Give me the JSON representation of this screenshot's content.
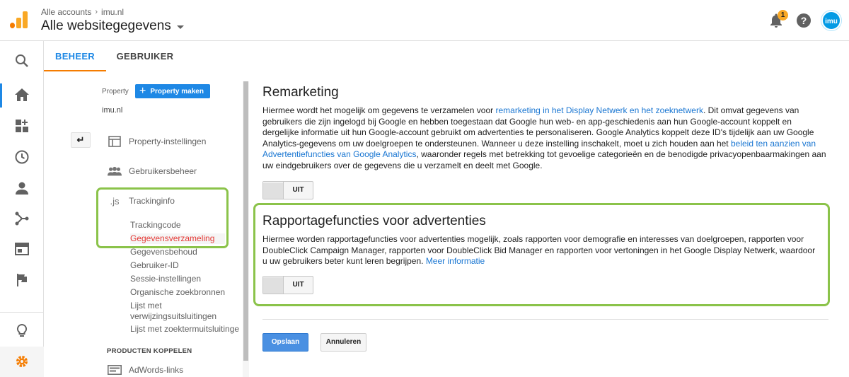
{
  "header": {
    "breadcrumb_account": "Alle accounts",
    "breadcrumb_property": "imu.nl",
    "title": "Alle websitegegevens",
    "notification_count": "1",
    "help_label": "?",
    "avatar_text": "imu"
  },
  "tabs": [
    {
      "label": "BEHEER",
      "active": true
    },
    {
      "label": "GEBRUIKER",
      "active": false
    }
  ],
  "rail_icons": [
    "search-icon",
    "home-icon",
    "dashboard-icon",
    "clock-icon",
    "person-icon",
    "acquisition-icon",
    "behavior-icon",
    "flag-icon",
    "lightbulb-icon",
    "gear-icon"
  ],
  "property": {
    "label": "Property",
    "create_button": "Property maken",
    "name": "imu.nl",
    "back_label": "↵"
  },
  "nav": {
    "items": [
      {
        "label": "Property-instellingen",
        "icon": "property-settings-icon"
      },
      {
        "label": "Gebruikersbeheer",
        "icon": "users-icon"
      },
      {
        "label": "Trackinginfo",
        "icon": "js-icon",
        "icon_text": ".js"
      }
    ],
    "tracking_sub": [
      {
        "label": "Trackingcode",
        "active": false
      },
      {
        "label": "Gegevensverzameling",
        "active": true
      },
      {
        "label": "Gegevensbehoud",
        "active": false
      },
      {
        "label": "Gebruiker-ID",
        "active": false
      },
      {
        "label": "Sessie-instellingen",
        "active": false
      },
      {
        "label": "Organische zoekbronnen",
        "active": false
      },
      {
        "label": "Lijst met",
        "active": false
      },
      {
        "label": "verwijzingsuitsluitingen",
        "active": false
      },
      {
        "label": "Lijst met zoektermuitsluitinge",
        "active": false
      }
    ],
    "section_heading": "PRODUCTEN KOPPELEN",
    "adwords": "AdWords-links"
  },
  "remarketing": {
    "title": "Remarketing",
    "text_1": "Hiermee wordt het mogelijk om gegevens te verzamelen voor ",
    "link_1": "remarketing in het Display Netwerk en het zoeknetwerk",
    "text_2": ". Dit omvat gegevens van gebruikers die zijn ingelogd bij Google en hebben toegestaan dat Google hun web- en app-geschiedenis aan hun Google-account koppelt en dergelijke informatie uit hun Google-account gebruikt om advertenties te personaliseren. Google Analytics koppelt deze ID's tijdelijk aan uw Google Analytics-gegevens om uw doelgroepen te ondersteunen. Wanneer u deze instelling inschakelt, moet u zich houden aan het ",
    "link_2": "beleid ten aanzien van Advertentiefuncties van Google Analytics",
    "text_3": ", waaronder regels met betrekking tot gevoelige categorieën en de benodigde privacyopenbaarmakingen aan uw eindgebruikers over de gegevens die u verzamelt en deelt met Google.",
    "toggle_label": "UIT"
  },
  "rapportage": {
    "title": "Rapportagefuncties voor advertenties",
    "text": "Hiermee worden rapportagefuncties voor advertenties mogelijk, zoals rapporten voor demografie en interesses van doelgroepen, rapporten voor DoubleClick Campaign Manager, rapporten voor DoubleClick Bid Manager en rapporten voor vertoningen in het Google Display Netwerk, waardoor u uw gebruikers beter kunt leren begrijpen. ",
    "link": "Meer informatie",
    "toggle_label": "UIT"
  },
  "actions": {
    "save": "Opslaan",
    "cancel": "Annuleren"
  },
  "colors": {
    "accent": "#1e88e5",
    "highlight": "#8bc34a",
    "active_nav": "#e53935",
    "tab_underline": "#f57c00"
  }
}
